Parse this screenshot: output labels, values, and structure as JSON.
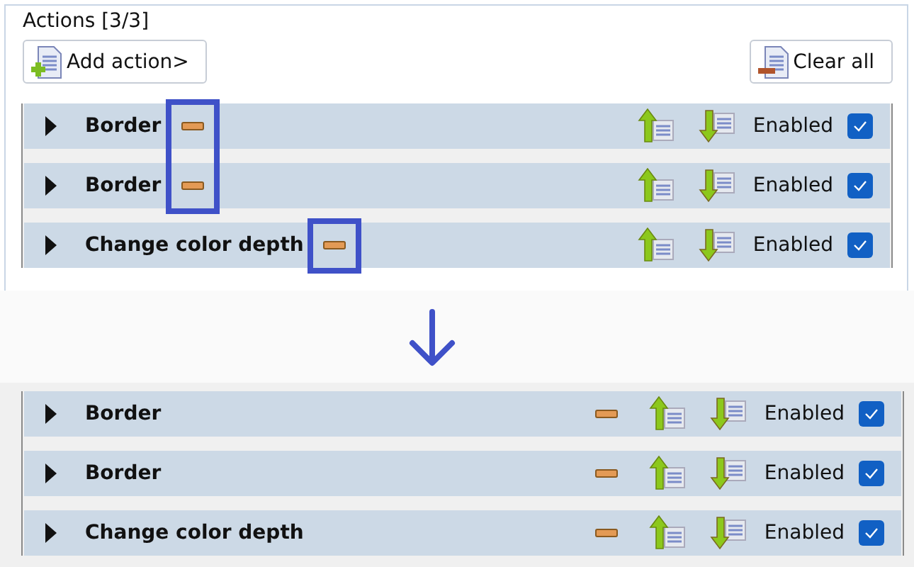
{
  "top": {
    "legend": "Actions [3/3]",
    "buttons": [
      {
        "kind": "add",
        "label": "Add action>"
      },
      {
        "kind": "clear",
        "label": "Clear all"
      }
    ],
    "rows": [
      {
        "kind": "inline",
        "name": "Border",
        "status": "Enabled",
        "enabled": true,
        "highlighted": true
      },
      {
        "kind": "inline",
        "name": "Border",
        "status": "Enabled",
        "enabled": true,
        "highlighted": true
      },
      {
        "kind": "inline",
        "name": "Change color depth",
        "status": "Enabled",
        "enabled": true,
        "highlighted": true
      }
    ]
  },
  "bottom": {
    "rows": [
      {
        "kind": "aligned",
        "name": "Border",
        "status": "Enabled",
        "enabled": true,
        "highlighted": false
      },
      {
        "kind": "aligned",
        "name": "Border",
        "status": "Enabled",
        "enabled": true,
        "highlighted": false
      },
      {
        "kind": "aligned",
        "name": "Change color depth",
        "status": "Enabled",
        "enabled": true,
        "highlighted": false
      }
    ]
  }
}
